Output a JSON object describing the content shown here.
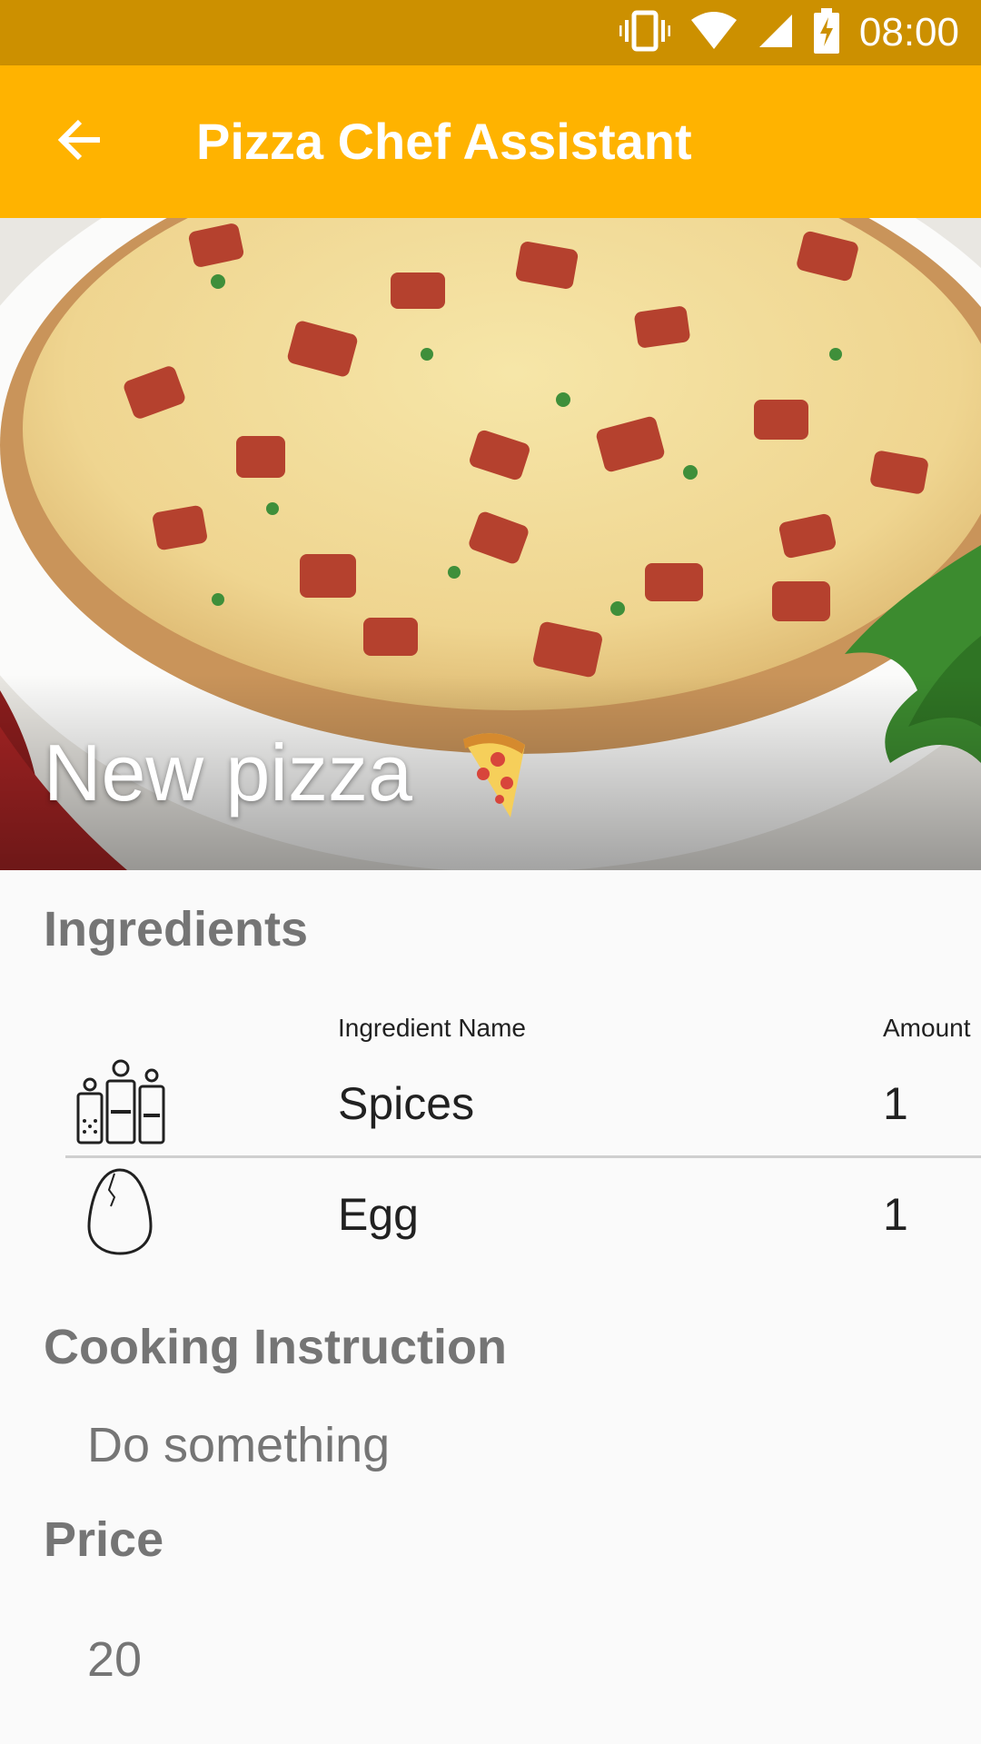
{
  "status_bar": {
    "time": "08:00",
    "icons": [
      "vibrate-icon",
      "wifi-icon",
      "cellular-signal-icon",
      "battery-charging-icon"
    ]
  },
  "app_bar": {
    "title": "Pizza Chef Assistant",
    "back_icon": "arrow-back-icon",
    "color": "#ffb300"
  },
  "hero": {
    "title": "New pizza",
    "emoji_icon": "pizza-slice-icon"
  },
  "ingredients": {
    "section_title": "Ingredients",
    "columns": {
      "name": "Ingredient Name",
      "amount": "Amount"
    },
    "rows": [
      {
        "icon": "spices-icon",
        "name": "Spices",
        "amount": "1"
      },
      {
        "icon": "egg-icon",
        "name": "Egg",
        "amount": "1"
      }
    ]
  },
  "cooking": {
    "section_title": "Cooking Instruction",
    "value": "Do something"
  },
  "price": {
    "section_title": "Price",
    "value": "20"
  }
}
